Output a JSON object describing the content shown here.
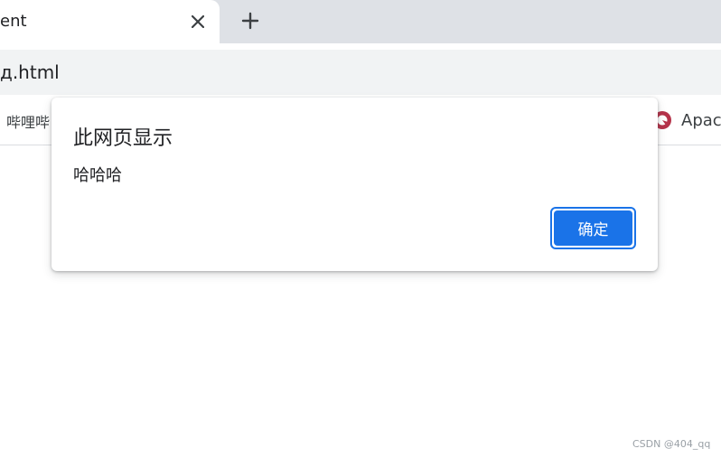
{
  "browser": {
    "tab": {
      "title": "ent",
      "close_icon": "close-icon"
    },
    "new_tab_icon": "plus-icon",
    "address_bar": {
      "url_text": "д.html"
    },
    "bookmarks": {
      "left_item_label": "哔哩哔",
      "right_item_label": "Apac",
      "right_item_icon": "apache-icon"
    }
  },
  "alert_dialog": {
    "title": "此网页显示",
    "message": "哈哈哈",
    "ok_button_label": "确定"
  },
  "watermark": {
    "text": "CSDN @404_qq"
  },
  "colors": {
    "accent": "#1a73e8",
    "tabstrip_bg": "#dee1e6",
    "omnibox_bg": "#f1f3f4",
    "text": "#202124"
  }
}
